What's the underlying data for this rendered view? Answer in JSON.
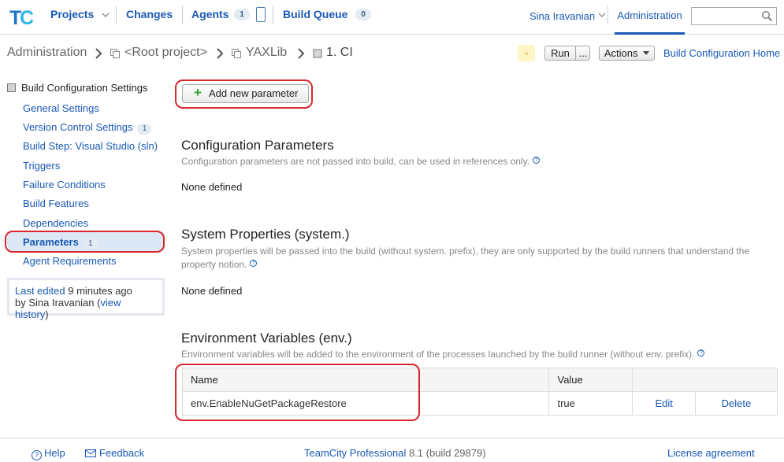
{
  "topnav": {
    "projects": "Projects",
    "changes": "Changes",
    "agents": "Agents",
    "agents_count": "1",
    "build_queue": "Build Queue",
    "build_queue_count": "0",
    "user": "Sina Iravanian",
    "administration": "Administration",
    "search_value": ""
  },
  "breadcrumb": {
    "items": [
      "Administration",
      "<Root project>",
      "YAXLib",
      "1. CI"
    ]
  },
  "toolbar": {
    "run": "Run",
    "run_more": "...",
    "actions": "Actions",
    "home": "Build Configuration Home"
  },
  "sidebar": {
    "title": "Build Configuration Settings",
    "items": [
      {
        "label": "General Settings",
        "badge": ""
      },
      {
        "label": "Version Control Settings",
        "badge": "1"
      },
      {
        "label": "Build Step: Visual Studio (sln)",
        "badge": ""
      },
      {
        "label": "Triggers",
        "badge": ""
      },
      {
        "label": "Failure Conditions",
        "badge": ""
      },
      {
        "label": "Build Features",
        "badge": ""
      },
      {
        "label": "Dependencies",
        "badge": ""
      },
      {
        "label": "Parameters",
        "badge": "1"
      },
      {
        "label": "Agent Requirements",
        "badge": ""
      }
    ],
    "last_edited_link": "Last edited",
    "last_edited_time": "9 minutes ago",
    "last_edited_by": "by Sina Iravanian (",
    "view_history": "view history",
    "close_paren": ")"
  },
  "main": {
    "add_button": "Add new parameter",
    "config": {
      "title": "Configuration Parameters",
      "desc": "Configuration parameters are not passed into build, can be used in references only.",
      "none": "None defined"
    },
    "system": {
      "title": "System Properties (system.)",
      "desc": "System properties will be passed into the build (without system. prefix), they are only supported by the build runners that understand the property notion.",
      "none": "None defined"
    },
    "env": {
      "title": "Environment Variables (env.)",
      "desc": "Environment variables will be added to the environment of the processes launched by the build runner (without env. prefix).",
      "col_name": "Name",
      "col_value": "Value",
      "rows": [
        {
          "name": "env.EnableNuGetPackageRestore",
          "value": "true",
          "edit": "Edit",
          "delete": "Delete"
        }
      ]
    }
  },
  "footer": {
    "help": "Help",
    "feedback": "Feedback",
    "product": "TeamCity Professional",
    "version": "8.1 (build 29879)",
    "license": "License agreement"
  },
  "colors": {
    "link": "#1a59b4",
    "highlight": "#d9272e",
    "active_bg": "#dde8f6"
  }
}
